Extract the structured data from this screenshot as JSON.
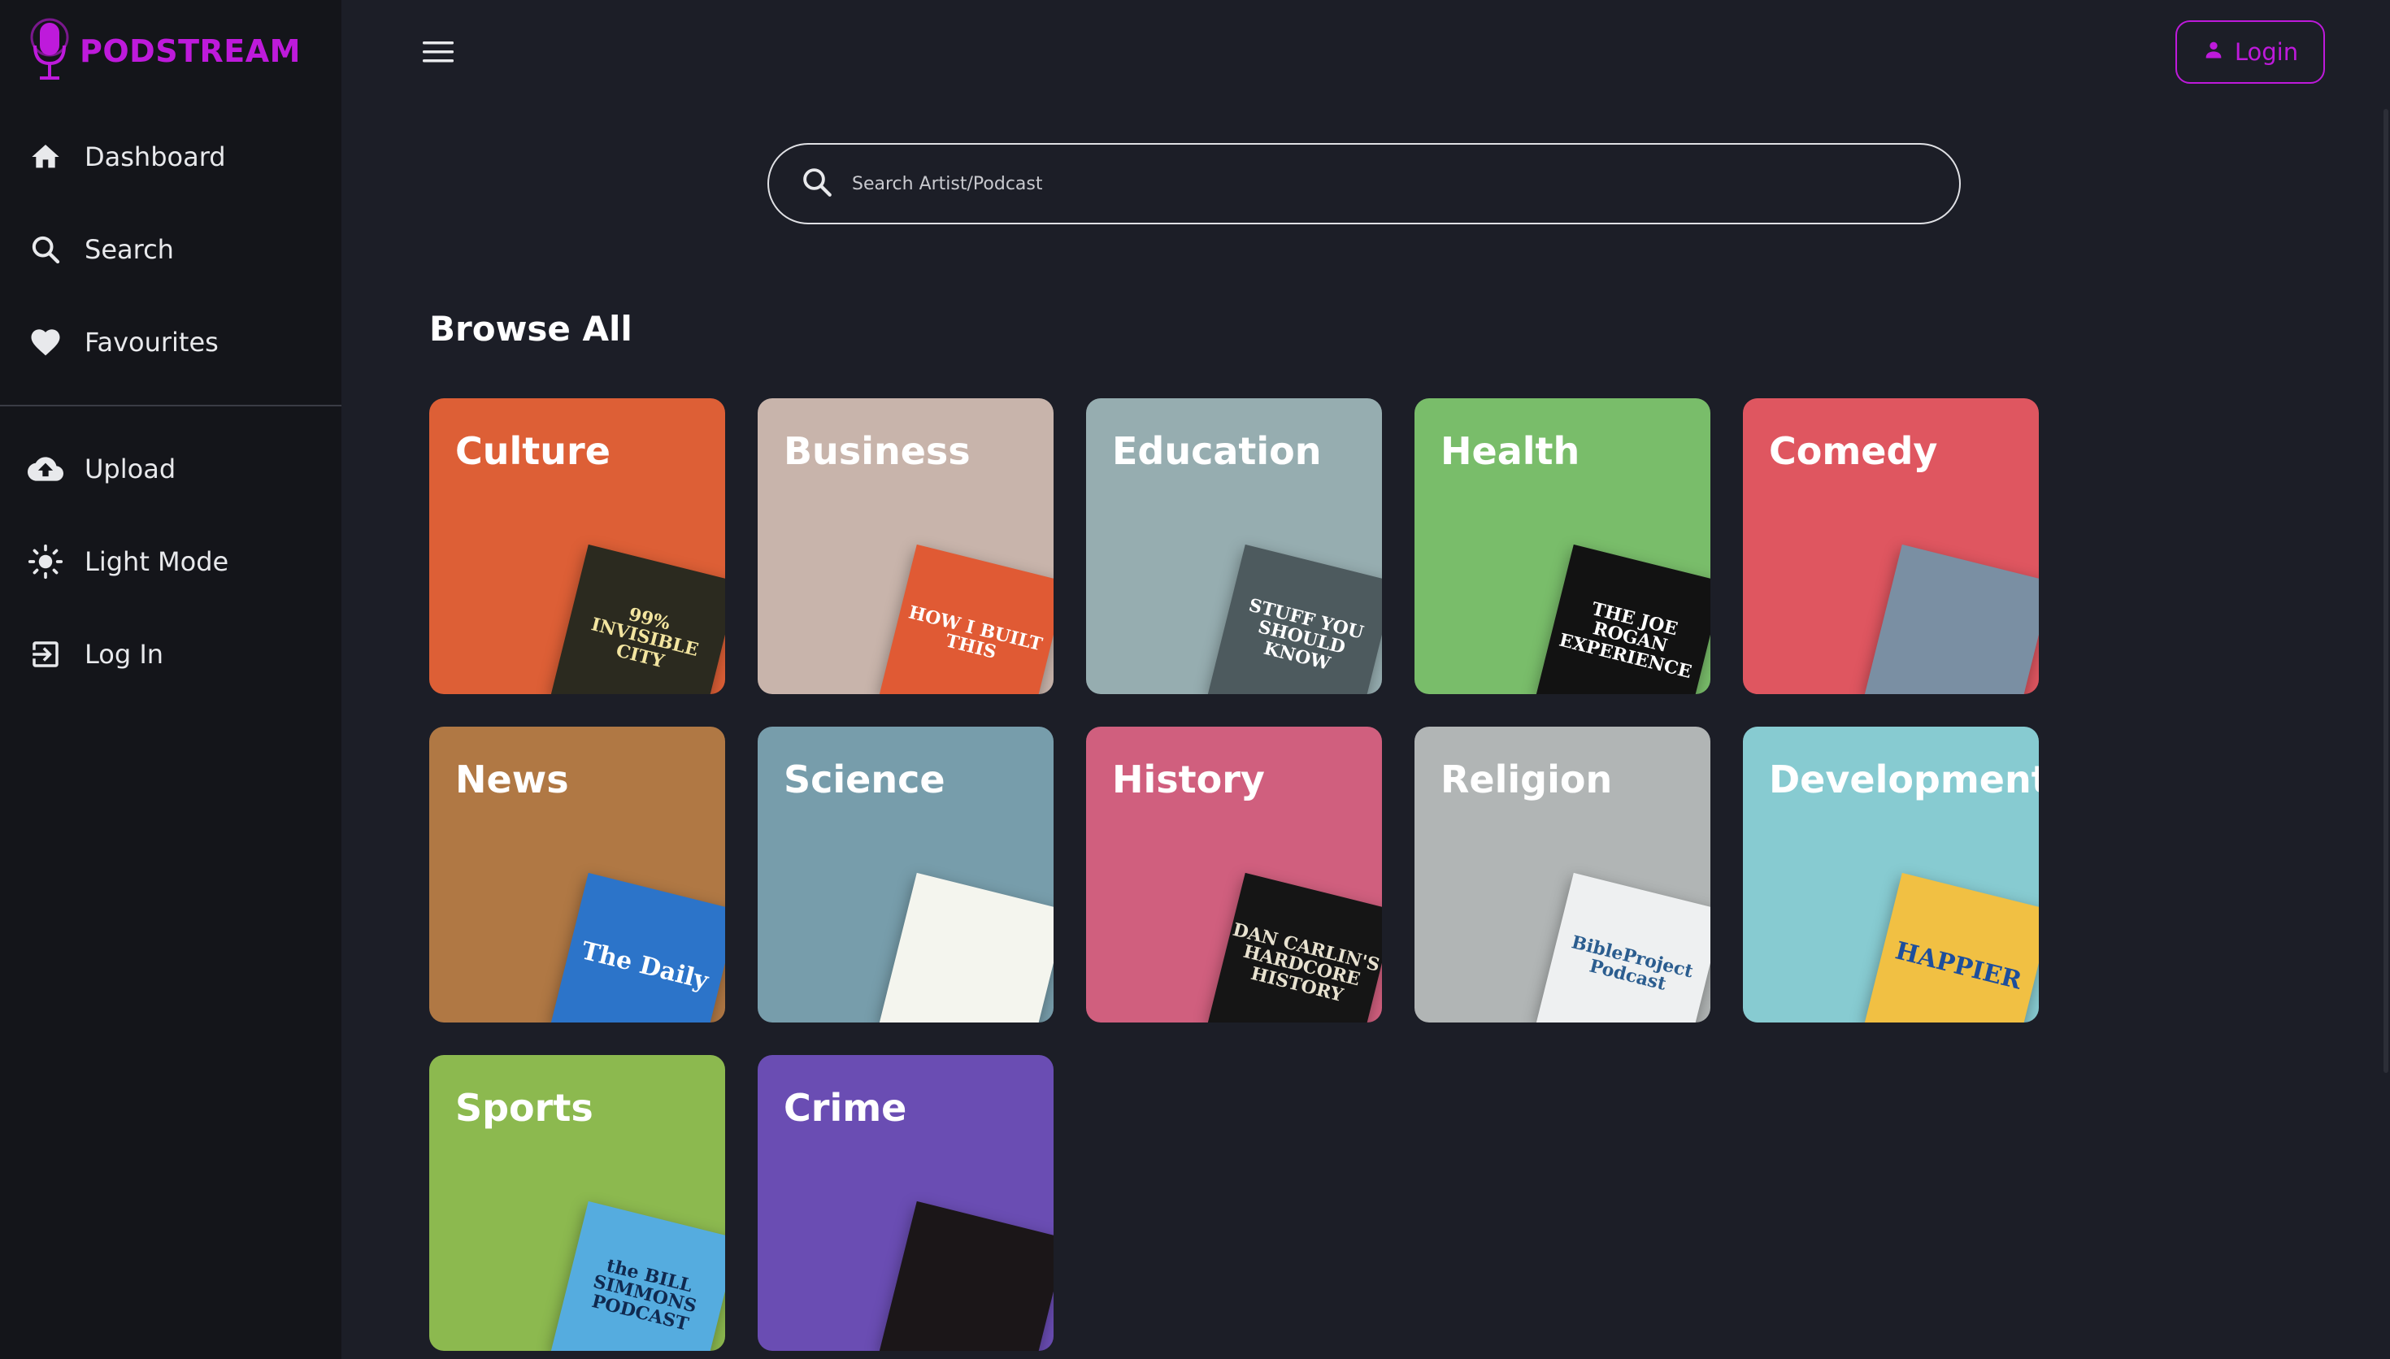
{
  "app": {
    "name": "PODSTREAM",
    "accent": "#be1adb"
  },
  "sidebar": {
    "top_items": [
      {
        "label": "Dashboard",
        "icon": "home-icon"
      },
      {
        "label": "Search",
        "icon": "search-icon"
      },
      {
        "label": "Favourites",
        "icon": "heart-icon"
      }
    ],
    "bottom_items": [
      {
        "label": "Upload",
        "icon": "cloud-upload-icon"
      },
      {
        "label": "Light Mode",
        "icon": "sun-icon"
      },
      {
        "label": "Log In",
        "icon": "login-icon"
      }
    ]
  },
  "header": {
    "login_label": "Login"
  },
  "search": {
    "placeholder": "Search Artist/Podcast"
  },
  "browse": {
    "title": "Browse All",
    "categories": [
      {
        "label": "Culture",
        "color": "#dd5f36",
        "cover_color": "#2b2a1f",
        "cover_text": "99% INVISIBLE CITY",
        "cover_text_color": "#f3e5a0"
      },
      {
        "label": "Business",
        "color": "#c8b4ab",
        "cover_color": "#e05a34",
        "cover_text": "HOW I BUILT THIS",
        "cover_text_color": "#ffffff"
      },
      {
        "label": "Education",
        "color": "#96adb0",
        "cover_color": "#4d5a5e",
        "cover_text": "STUFF YOU SHOULD KNOW",
        "cover_text_color": "#ffffff"
      },
      {
        "label": "Health",
        "color": "#79bd6a",
        "cover_color": "#121212",
        "cover_text": "THE JOE ROGAN EXPERIENCE",
        "cover_text_color": "#ffffff"
      },
      {
        "label": "Comedy",
        "color": "#df5660",
        "cover_color": "#7a8fa3",
        "cover_text": "",
        "cover_text_color": "#ffffff"
      },
      {
        "label": "News",
        "color": "#b07844",
        "cover_color": "#2c74c9",
        "cover_text": "The Daily",
        "cover_text_color": "#ffffff"
      },
      {
        "label": "Science",
        "color": "#779dab",
        "cover_color": "#f4f5ee",
        "cover_text": "",
        "cover_text_color": "#2f9a3b"
      },
      {
        "label": "History",
        "color": "#d05f7e",
        "cover_color": "#151515",
        "cover_text": "DAN CARLIN'S HARDCORE HISTORY",
        "cover_text_color": "#e8e2d0"
      },
      {
        "label": "Religion",
        "color": "#b1b5b5",
        "cover_color": "#eef0f1",
        "cover_text": "BibleProject Podcast",
        "cover_text_color": "#2b5d8f"
      },
      {
        "label": "Development",
        "color": "#87cbd1",
        "cover_color": "#f1c043",
        "cover_text": "HAPPIER",
        "cover_text_color": "#1d4e9c"
      },
      {
        "label": "Sports",
        "color": "#8cb94f",
        "cover_color": "#55acdf",
        "cover_text": "the BILL SIMMONS PODCAST",
        "cover_text_color": "#10294f"
      },
      {
        "label": "Crime",
        "color": "#6a4db3",
        "cover_color": "#1b1618",
        "cover_text": "",
        "cover_text_color": "#ffffff"
      }
    ]
  }
}
